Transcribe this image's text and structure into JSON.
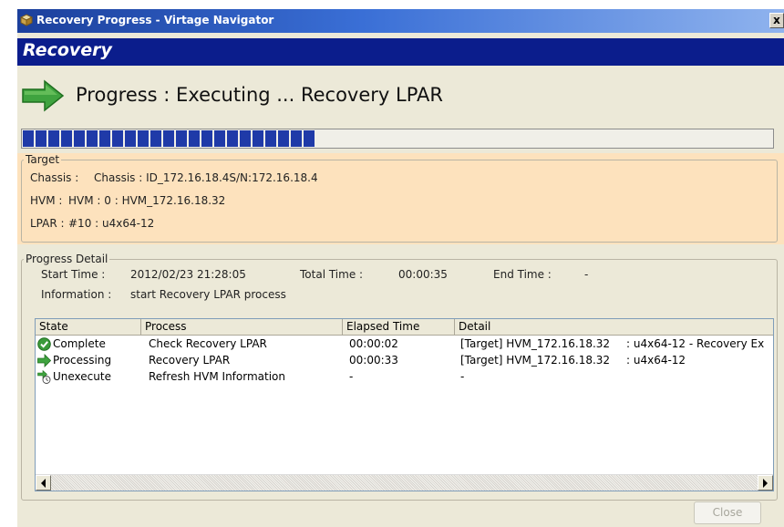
{
  "window": {
    "title": "Recovery Progress - Virtage Navigator",
    "close_glyph": "x"
  },
  "banner": {
    "title": "Recovery"
  },
  "heading": {
    "text": "Progress : Executing ... Recovery LPAR",
    "icon": "green-arrow-icon"
  },
  "progress": {
    "fraction": 0.4,
    "color": "#1f3aa8"
  },
  "target": {
    "legend": "Target",
    "chassis_label": "Chassis :",
    "chassis_value": "Chassis : ID_172.16.18.4S/N:172.16.18.4",
    "hvm_label": "HVM :",
    "hvm_value": "HVM : 0 : HVM_172.16.18.32",
    "lpar_label": "LPAR :",
    "lpar_value": "#10 : u4x64-12",
    "band_color": "#fde2bd"
  },
  "progress_detail": {
    "legend": "Progress Detail",
    "start_time_label": "Start Time :",
    "start_time_value": "2012/02/23 21:28:05",
    "total_time_label": "Total Time :",
    "total_time_value": "00:00:35",
    "end_time_label": "End Time :",
    "end_time_value": "-",
    "information_label": "Information :",
    "information_value": "start Recovery LPAR process"
  },
  "table": {
    "columns": [
      "State",
      "Process",
      "Elapsed Time",
      "Detail"
    ],
    "rows": [
      {
        "state": "Complete",
        "state_icon": "check-circle-icon",
        "process": "Check Recovery LPAR",
        "elapsed": "00:00:02",
        "detail_target": "[Target] HVM_172.16.18.32",
        "detail_text": ": u4x64-12 - Recovery Ex"
      },
      {
        "state": "Processing",
        "state_icon": "green-arrow-icon",
        "process": "Recovery LPAR",
        "elapsed": "00:00:33",
        "detail_target": "[Target] HVM_172.16.18.32",
        "detail_text": ": u4x64-12"
      },
      {
        "state": "Unexecute",
        "state_icon": "arrow-clock-icon",
        "process": "Refresh HVM Information",
        "elapsed": "-",
        "detail_target": "-",
        "detail_text": ""
      }
    ]
  },
  "buttons": {
    "close_label": "Close"
  }
}
